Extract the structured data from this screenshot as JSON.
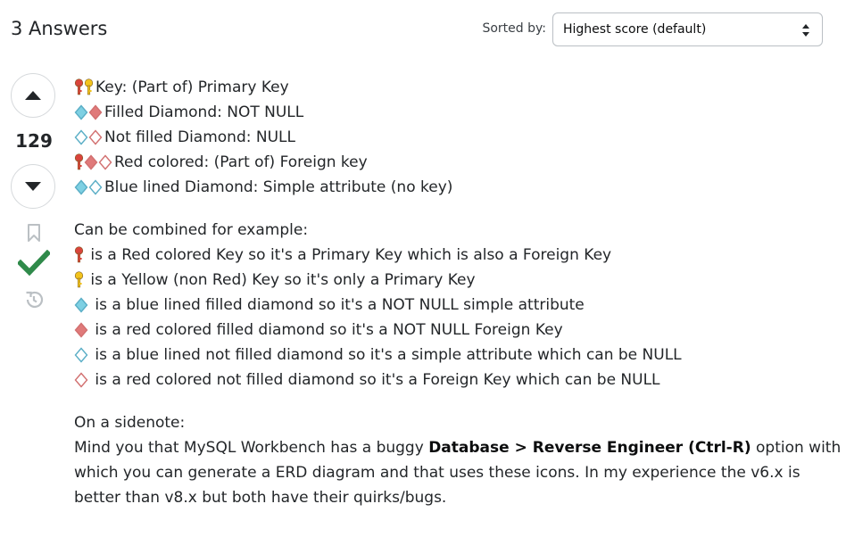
{
  "header": {
    "answers_count": "3 Answers",
    "sort_label": "Sorted by:",
    "sort_value": "Highest score (default)"
  },
  "vote": {
    "score": "129"
  },
  "colors": {
    "accepted": "#2f8a4a",
    "vote_arrow": "#232629",
    "icon_gray": "#bbc0c4",
    "key_red": "#d9443c",
    "key_yellow": "#f2c31d",
    "diamond_blue": "#7ed0e3",
    "diamond_red": "#e07a7a"
  },
  "legend": [
    {
      "icons": [
        "key-red",
        "key-yellow"
      ],
      "text": "Key: (Part of) Primary Key"
    },
    {
      "icons": [
        "diamond-blue-filled",
        "diamond-red-filled"
      ],
      "text": "Filled Diamond: NOT NULL"
    },
    {
      "icons": [
        "diamond-blue-empty",
        "diamond-red-empty"
      ],
      "text": "Not filled Diamond: NULL"
    },
    {
      "icons": [
        "key-red",
        "diamond-red-filled",
        "diamond-red-empty"
      ],
      "text": "Red colored: (Part of) Foreign key"
    },
    {
      "icons": [
        "diamond-blue-filled",
        "diamond-blue-empty"
      ],
      "text": "Blue lined Diamond: Simple attribute (no key)"
    }
  ],
  "combined_intro": "Can be combined for example:",
  "combined": [
    {
      "icons": [
        "key-red"
      ],
      "text": " is a Red colored Key so it's a Primary Key which is also a Foreign Key"
    },
    {
      "icons": [
        "key-yellow"
      ],
      "text": " is a Yellow (non Red) Key so it's only a Primary Key"
    },
    {
      "icons": [
        "diamond-blue-filled"
      ],
      "text": " is a blue lined filled diamond so it's a NOT NULL simple attribute"
    },
    {
      "icons": [
        "diamond-red-filled"
      ],
      "text": " is a red colored filled diamond so it's a NOT NULL Foreign Key"
    },
    {
      "icons": [
        "diamond-blue-empty"
      ],
      "text": " is a blue lined not filled diamond so it's a simple attribute which can be NULL"
    },
    {
      "icons": [
        "diamond-red-empty"
      ],
      "text": " is a red colored not filled diamond so it's a Foreign Key which can be NULL"
    }
  ],
  "sidenote": {
    "heading": "On a sidenote:",
    "line1_before": "Mind you that MySQL Workbench has a buggy ",
    "line1_bold": "Database > Reverse Engineer (Ctrl-R)",
    "line1_after": " option with",
    "line2": "which you can generate a ERD diagram and that uses these icons. In my experience the v6.x is",
    "line3": "better than v8.x but both have their quirks/bugs."
  }
}
